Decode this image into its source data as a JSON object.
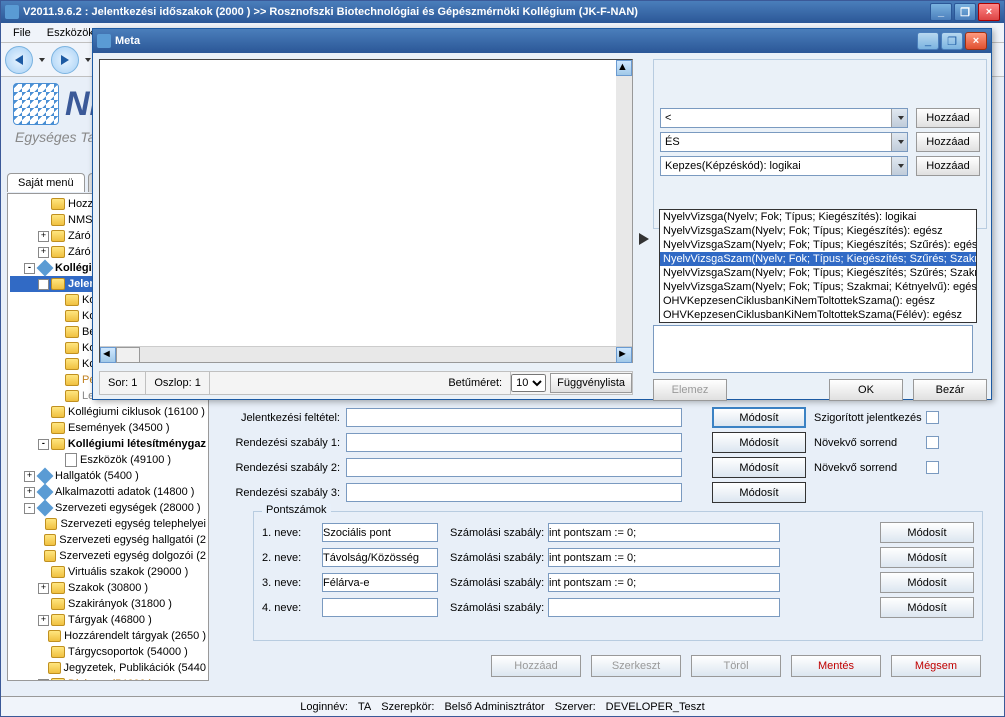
{
  "main": {
    "title": "V2011.9.6.2 : Jelentkezési időszakok (2000  )  >> Rosznofszki Biotechnológiai és Gépészmérnöki Kollégium (JK-F-NAN)",
    "menu": {
      "file": "File",
      "tools": "Eszközök"
    },
    "logo_text": "NE",
    "logo_sub": "Egységes Tar",
    "tabs": {
      "own": "Saját menü",
      "all": "Ált"
    }
  },
  "tree": [
    {
      "ind": 28,
      "toggle": "",
      "icon": "folder",
      "label": "Hozzá"
    },
    {
      "ind": 28,
      "toggle": "",
      "icon": "folder",
      "label": "NMS"
    },
    {
      "ind": 28,
      "toggle": "+",
      "icon": "folder",
      "label": "Záró"
    },
    {
      "ind": 28,
      "toggle": "+",
      "icon": "folder",
      "label": "Záró"
    },
    {
      "ind": 14,
      "toggle": "-",
      "icon": "blue",
      "label": "Kollégium",
      "bold": true
    },
    {
      "ind": 28,
      "toggle": "-",
      "icon": "folder",
      "label": "Jeler",
      "selected": true,
      "bold": true
    },
    {
      "ind": 42,
      "toggle": "",
      "icon": "folder",
      "label": "Kollég"
    },
    {
      "ind": 42,
      "toggle": "",
      "icon": "folder",
      "label": "Kollég"
    },
    {
      "ind": 42,
      "toggle": "",
      "icon": "folder",
      "label": "Beköl"
    },
    {
      "ind": 42,
      "toggle": "",
      "icon": "folder",
      "label": "Kollég"
    },
    {
      "ind": 42,
      "toggle": "",
      "icon": "folder",
      "label": "Kollég"
    },
    {
      "ind": 42,
      "toggle": "",
      "icon": "folder",
      "label": "Pénzü",
      "orange": true
    },
    {
      "ind": 42,
      "toggle": "",
      "icon": "folder",
      "label": "Leltár",
      "gray": true
    },
    {
      "ind": 28,
      "toggle": "",
      "icon": "folder",
      "label": "Kollégiumi ciklusok (16100  )"
    },
    {
      "ind": 28,
      "toggle": "",
      "icon": "folder",
      "label": "Események (34500  )"
    },
    {
      "ind": 28,
      "toggle": "-",
      "icon": "folder",
      "label": "Kollégiumi létesítménygaz",
      "bold": true
    },
    {
      "ind": 42,
      "toggle": "",
      "icon": "file",
      "label": "Eszközök (49100  )"
    },
    {
      "ind": 14,
      "toggle": "+",
      "icon": "blue",
      "label": "Hallgatók (5400  )"
    },
    {
      "ind": 14,
      "toggle": "+",
      "icon": "blue",
      "label": "Alkalmazotti adatok (14800  )"
    },
    {
      "ind": 14,
      "toggle": "-",
      "icon": "blue",
      "label": "Szervezeti egységek (28000  )"
    },
    {
      "ind": 28,
      "toggle": "",
      "icon": "folder",
      "label": "Szervezeti egység telephelyei"
    },
    {
      "ind": 28,
      "toggle": "",
      "icon": "folder",
      "label": "Szervezeti egység hallgatói (2"
    },
    {
      "ind": 28,
      "toggle": "",
      "icon": "folder",
      "label": "Szervezeti egység dolgozói (2"
    },
    {
      "ind": 28,
      "toggle": "",
      "icon": "folder",
      "label": "Virtuális szakok (29000  )"
    },
    {
      "ind": 28,
      "toggle": "+",
      "icon": "folder",
      "label": "Szakok (30800  )"
    },
    {
      "ind": 28,
      "toggle": "",
      "icon": "folder",
      "label": "Szakirányok (31800  )"
    },
    {
      "ind": 28,
      "toggle": "+",
      "icon": "folder",
      "label": "Tárgyak (46800  )"
    },
    {
      "ind": 28,
      "toggle": "",
      "icon": "folder",
      "label": "Hozzárendelt tárgyak (2650  )"
    },
    {
      "ind": 28,
      "toggle": "",
      "icon": "folder",
      "label": "Tárgycsoportok (54000  )"
    },
    {
      "ind": 28,
      "toggle": "",
      "icon": "folder",
      "label": "Jegyzetek, Publikációk (5440"
    },
    {
      "ind": 28,
      "toggle": "+",
      "icon": "folder",
      "label": "Diploma (54600  )",
      "orange": true
    }
  ],
  "form": {
    "cond_label": "Jelentkezési feltétel:",
    "cond_val": "",
    "r1_label": "Rendezési szabály 1:",
    "r1_val": "",
    "r2_label": "Rendezési szabály 2:",
    "r2_val": "",
    "r3_label": "Rendezési szabály 3:",
    "r3_val": "",
    "btn_mod": "Módosít",
    "chk1_label": "Szigorított jelentkezés",
    "chk2_label": "Növekvő sorrend",
    "chk3_label": "Növekvő sorrend"
  },
  "points": {
    "legend": "Pontszámok",
    "n1_label": "1. neve:",
    "n1": "Szociális pont",
    "n2_label": "2. neve:",
    "n2": "Távolság/Közösség",
    "n3_label": "3. neve:",
    "n3": "Félárva-e",
    "n4_label": "4. neve:",
    "n4": "",
    "rule_label": "Számolási szabály:",
    "r1": "int pontszam := 0;",
    "r2": "int pontszam := 0;",
    "r3": "int pontszam := 0;",
    "r4": "",
    "btn_mod": "Módosít"
  },
  "bottom": {
    "add": "Hozzáad",
    "edit": "Szerkeszt",
    "del": "Töröl",
    "save": "Mentés",
    "cancel": "Mégsem"
  },
  "status": {
    "login_l": "Loginnév:",
    "login": "TA",
    "role_l": "Szerepkör:",
    "role": "Belső Adminisztrátor",
    "srv_l": "Szerver:",
    "srv": "DEVELOPER_Teszt"
  },
  "dialog": {
    "title": "Meta",
    "status": {
      "row_l": "Sor:",
      "row": "1",
      "col_l": "Oszlop:",
      "col": "1",
      "font_l": "Betűméret:",
      "font": "10",
      "fnlist": "Függvénylista"
    },
    "rp": {
      "sel1": "<",
      "sel2": "ÉS",
      "sel3": "Kepzes(Képzéskód): logikai",
      "btn_add": "Hozzáad",
      "dropdown": [
        {
          "t": "NyelvVizsga(Nyelv; Fok; Típus; Kiegészítés): logikai"
        },
        {
          "t": "NyelvVizsgaSzam(Nyelv; Fok; Típus; Kiegészítés): egész"
        },
        {
          "t": "NyelvVizsgaSzam(Nyelv; Fok; Típus; Kiegészítés; Szűrés): egész"
        },
        {
          "t": "NyelvVizsgaSzam(Nyelv; Fok; Típus; Kiegészítés; Szűrés; Szakmai):",
          "sel": true
        },
        {
          "t": "NyelvVizsgaSzam(Nyelv; Fok; Típus; Kiegészítés; Szűrés; Szakmai; I"
        },
        {
          "t": "NyelvVizsgaSzam(Nyelv; Fok; Típus; Szakmai; Kétnyelvű): egész"
        },
        {
          "t": "OHVKepzesenCiklusbanKiNemToltottekSzama(): egész"
        },
        {
          "t": "OHVKepzesenCiklusbanKiNemToltottekSzama(Félév): egész"
        }
      ],
      "elemez": "Elemez",
      "ok": "OK",
      "close": "Bezár"
    }
  }
}
